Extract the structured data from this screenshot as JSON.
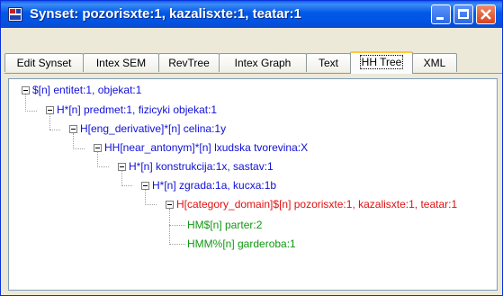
{
  "window": {
    "title": "Synset: pozorisxte:1, kazalisxte:1, teatar:1"
  },
  "tabs": [
    {
      "label": "Edit Synset",
      "active": false
    },
    {
      "label": "Intex SEM",
      "active": false
    },
    {
      "label": "RevTree",
      "active": false
    },
    {
      "label": "Intex Graph",
      "active": false
    },
    {
      "label": "Text",
      "active": false
    },
    {
      "label": "HH Tree",
      "active": true
    },
    {
      "label": "XML",
      "active": false
    }
  ],
  "tree": [
    {
      "label": "$[n] entitet:1, objekat:1",
      "level": 0,
      "color": "#1010d8"
    },
    {
      "label": "H*[n] predmet:1, fizicyki objekat:1",
      "level": 1,
      "color": "#1010d8"
    },
    {
      "label": "H[eng_derivative]*[n] celina:1y",
      "level": 2,
      "color": "#1010d8"
    },
    {
      "label": "HH[near_antonym]*[n] lxudska tvorevina:X",
      "level": 3,
      "color": "#1010d8"
    },
    {
      "label": "H*[n] konstrukcija:1x, sastav:1",
      "level": 4,
      "color": "#1010d8"
    },
    {
      "label": "H*[n] zgrada:1a, kucxa:1b",
      "level": 5,
      "color": "#1010d8"
    },
    {
      "label": "H[category_domain]$[n] pozorisxte:1, kazalisxte:1, teatar:1",
      "level": 6,
      "color": "#e01010"
    },
    {
      "label": "HM$[n] parter:2",
      "level": 7,
      "color": "#119911"
    },
    {
      "label": "HMM%[n] garderoba:1",
      "level": 7,
      "color": "#119911"
    }
  ],
  "colors": {
    "title_bar": "#0058e6",
    "node_default": "#1010d8",
    "node_selected_synset": "#e01010",
    "node_leaf": "#119911"
  }
}
